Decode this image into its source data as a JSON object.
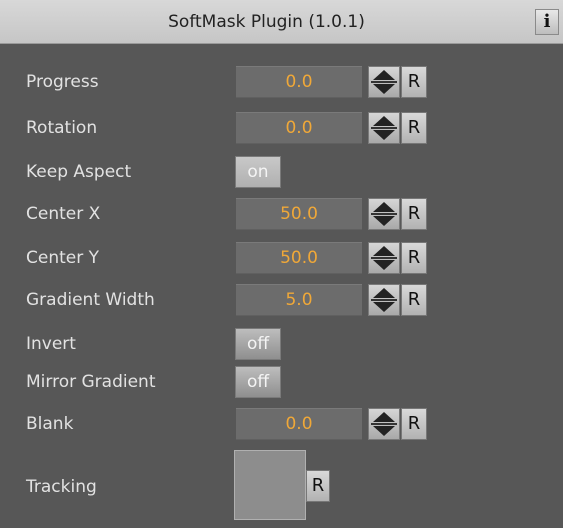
{
  "panel": {
    "title": "SoftMask Plugin (1.0.1)",
    "info_label": "i"
  },
  "params": [
    {
      "label": "Progress",
      "value": "0.0",
      "reset": "R"
    },
    {
      "label": "Rotation",
      "value": "0.0",
      "reset": "R"
    },
    {
      "label": "Keep Aspect",
      "toggle": "on"
    },
    {
      "label": "Center X",
      "value": "50.0",
      "reset": "R"
    },
    {
      "label": "Center Y",
      "value": "50.0",
      "reset": "R"
    },
    {
      "label": "Gradient Width",
      "value": "5.0",
      "reset": "R"
    },
    {
      "label": "Invert",
      "toggle": "off"
    },
    {
      "label": "Mirror Gradient",
      "toggle": "off"
    },
    {
      "label": "Blank",
      "value": "0.0",
      "reset": "R"
    },
    {
      "label": "Tracking",
      "reset": "R"
    }
  ],
  "colors": {
    "background": "#575757",
    "value_text": "#f0a838",
    "label_text": "#e2e2e2"
  }
}
